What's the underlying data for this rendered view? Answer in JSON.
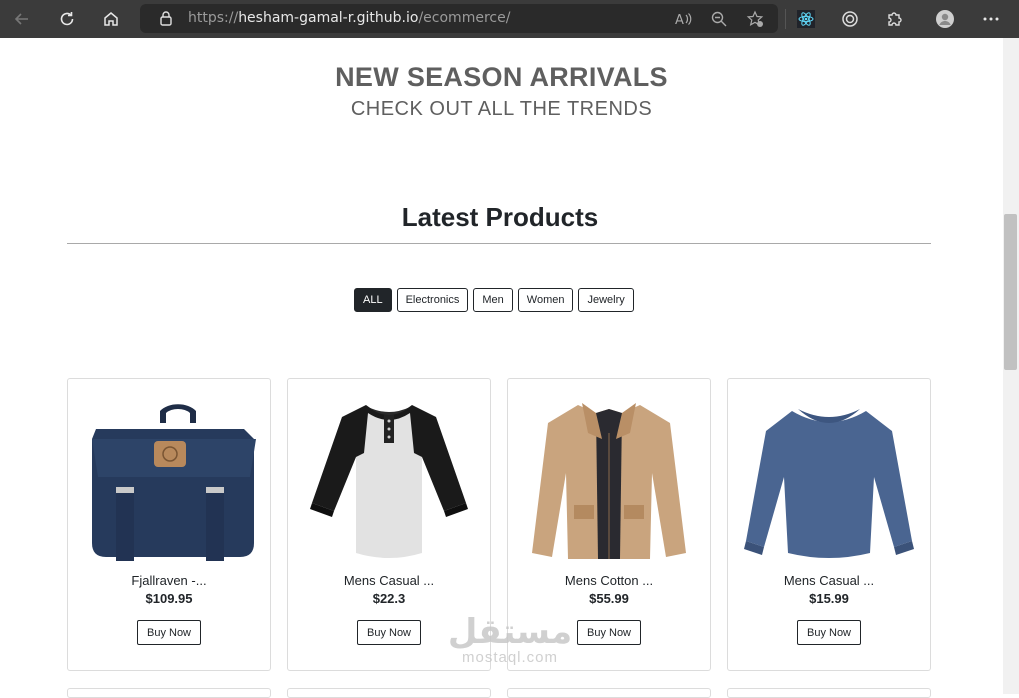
{
  "browser": {
    "url_prefix": "https://",
    "url_host": "hesham-gamal-r.github.io",
    "url_path": "/ecommerce/"
  },
  "hero": {
    "title": "NEW SEASON ARRIVALS",
    "subtitle": "CHECK OUT ALL THE TRENDS"
  },
  "section": {
    "title": "Latest Products"
  },
  "filters": [
    {
      "label": "ALL",
      "active": true
    },
    {
      "label": "Electronics",
      "active": false
    },
    {
      "label": "Men",
      "active": false
    },
    {
      "label": "Women",
      "active": false
    },
    {
      "label": "Jewelry",
      "active": false
    }
  ],
  "products": [
    {
      "name": "Fjallraven -...",
      "price": "$109.95",
      "button": "Buy Now"
    },
    {
      "name": "Mens Casual ...",
      "price": "$22.3",
      "button": "Buy Now"
    },
    {
      "name": "Mens Cotton ...",
      "price": "$55.99",
      "button": "Buy Now"
    },
    {
      "name": "Mens Casual ...",
      "price": "$15.99",
      "button": "Buy Now"
    }
  ],
  "watermark": {
    "arabic": "مستقل",
    "latin": "mostaql.com"
  },
  "colors": {
    "chrome_bg": "#3b3b3b",
    "address_bg": "#2a2a2a",
    "dark": "#212529",
    "hero_text": "#5f5f5f"
  }
}
